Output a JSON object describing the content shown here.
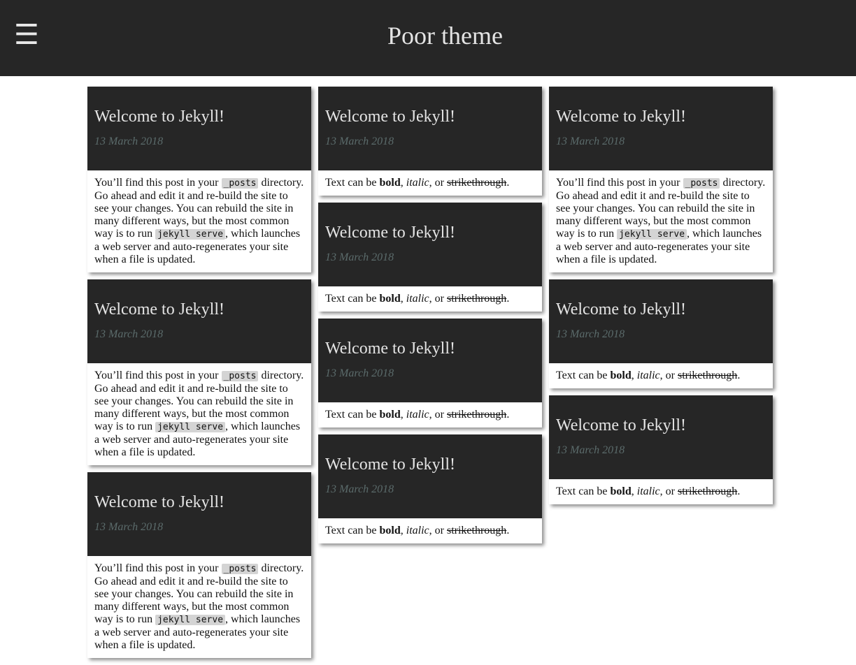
{
  "header": {
    "menu_glyph": "☰",
    "title": "Poor theme"
  },
  "post": {
    "title": "Welcome to Jekyll!",
    "date": "13 March 2018"
  },
  "excerpt_long": {
    "part1": "You’ll find this post in your ",
    "code1": "_posts",
    "part2": " directory. Go ahead and edit it and re-build the site to see your changes. You can rebuild the site in many different ways, but the most common way is to run ",
    "code2": "jekyll serve",
    "part3": ", which launches a web server and auto-regenerates your site when a file is updated."
  },
  "excerpt_short": {
    "part1": "Text can be ",
    "bold": "bold",
    "sep1": ", ",
    "italic": "italic",
    "sep2": ", or ",
    "strike": "strikethrough",
    "end": "."
  },
  "columns": [
    [
      "long",
      "long",
      "long"
    ],
    [
      "short",
      "short",
      "short",
      "short"
    ],
    [
      "long",
      "short",
      "short"
    ]
  ]
}
